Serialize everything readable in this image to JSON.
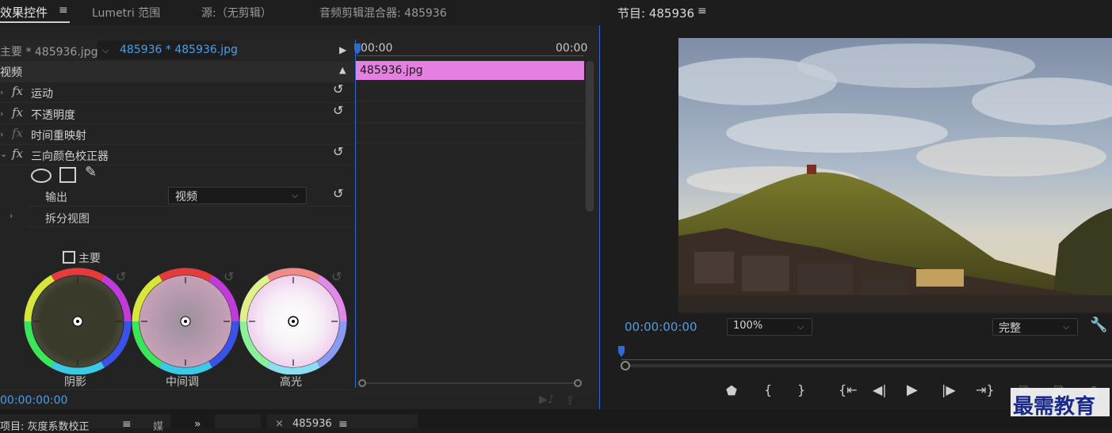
{
  "left_panel": {
    "tabs": [
      "效果控件",
      "Lumetri 范围",
      "源:（无剪辑）",
      "音频剪辑混合器: 485936"
    ],
    "master_clip": "主要 * 485936.jpg",
    "clip_selector": "485936 * 485936.jpg",
    "timeline_start": "00:00",
    "timeline_end": "00:00",
    "clip_bar_label": "485936.jpg",
    "clip_bar_color": "#e481e0",
    "section_video": "视频",
    "effects": [
      {
        "name": "运动"
      },
      {
        "name": "不透明度"
      },
      {
        "name": "时间重映射"
      },
      {
        "name": "三向颜色校正器"
      }
    ],
    "output_label": "输出",
    "output_value": "视频",
    "split_view_label": "拆分视图",
    "main_checkbox_label": "主要",
    "wheels": [
      "阴影",
      "中间调",
      "高光"
    ],
    "current_time": "00:00:00:00"
  },
  "program_monitor": {
    "title": "节目: 485936",
    "timecode": "00:00:00:00",
    "zoom": "100%",
    "quality": "完整"
  },
  "bottom_tabs": [
    "项目: 灰度系数校正",
    "媒",
    "485936"
  ],
  "watermark": "最需教育"
}
